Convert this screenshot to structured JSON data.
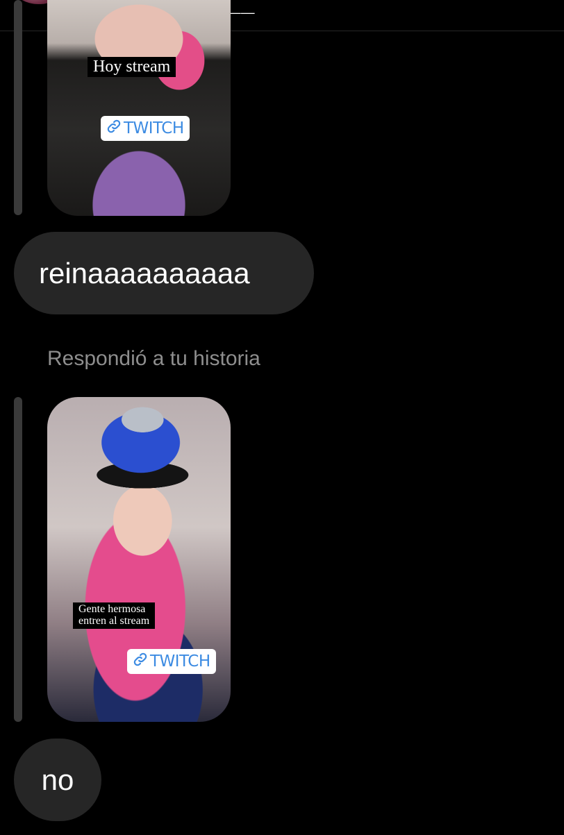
{
  "header": {
    "username": "_.starrats.___"
  },
  "messages": {
    "story_1": {
      "caption": "Hoy stream",
      "link_label": "TWITCH"
    },
    "bubble_1": "reinaaaaaaaaaa",
    "reply_label": "Respondió a tu historia",
    "story_2": {
      "caption_line1": "Gente hermosa",
      "caption_line2": "entren al stream",
      "link_label": "TWITCH"
    },
    "bubble_2": "no"
  },
  "icons": {
    "link": "link-icon"
  },
  "colors": {
    "background": "#000000",
    "bubble": "#262626",
    "reply_label": "#8e8e8e",
    "twitch_link": "#3c8be2"
  }
}
